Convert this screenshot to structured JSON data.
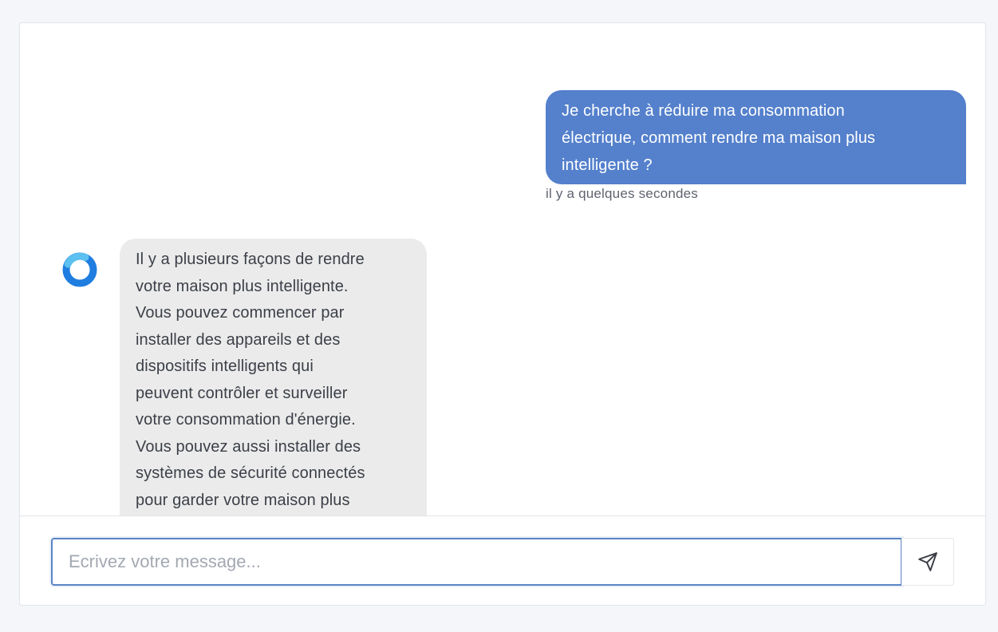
{
  "conversation": {
    "user_message": {
      "lines": [
        "Je cherche à réduire ma consommation",
        "électrique, comment rendre ma maison plus",
        "intelligente ?"
      ],
      "timestamp": "il y a quelques secondes"
    },
    "bot_message": {
      "avatar_icon": "assistant-ring-logo",
      "lines": [
        "Il y a plusieurs façons de rendre",
        "votre maison plus intelligente.",
        "Vous pouvez commencer par",
        "installer des appareils et des",
        "dispositifs intelligents qui",
        "peuvent contrôler et surveiller",
        "votre consommation d'énergie.",
        "Vous pouvez aussi installer des",
        "systèmes de sécurité connectés",
        "pour garder votre maison plus"
      ]
    }
  },
  "composer": {
    "placeholder": "Ecrivez votre message...",
    "value": "",
    "send_icon": "send-icon"
  },
  "colors": {
    "user_bubble": "#5480cc",
    "bot_bubble": "#ebebeb",
    "input_border": "#5b84c4",
    "background": "#f4f6fa"
  }
}
